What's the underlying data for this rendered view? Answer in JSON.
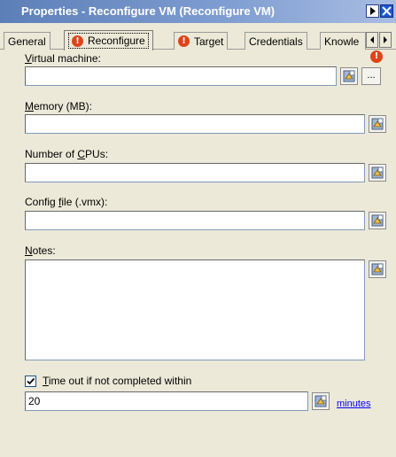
{
  "window": {
    "title": "Properties - Reconfigure VM (Reconfigure VM)"
  },
  "tabs": [
    {
      "label": "General",
      "error": false
    },
    {
      "label": "Reconfigure",
      "error": true
    },
    {
      "label": "Target",
      "error": true
    },
    {
      "label": "Credentials",
      "error": false
    },
    {
      "label": "Knowle",
      "error": false
    }
  ],
  "fields": {
    "virtual_machine": {
      "label_pre": "",
      "label_key": "V",
      "label_post": "irtual machine:",
      "value": ""
    },
    "memory": {
      "label_pre": "",
      "label_key": "M",
      "label_post": "emory (MB):",
      "value": ""
    },
    "cpus": {
      "label_pre": "Number of ",
      "label_key": "C",
      "label_post": "PUs:",
      "value": ""
    },
    "config_file": {
      "label_pre": "Config ",
      "label_key": "f",
      "label_post": "ile (.vmx):",
      "value": ""
    },
    "notes": {
      "label_pre": "",
      "label_key": "N",
      "label_post": "otes:",
      "value": ""
    }
  },
  "browse_label": "...",
  "timeout": {
    "checked": true,
    "label_pre": "",
    "label_key": "T",
    "label_post": "ime out if not completed within",
    "value": "20",
    "unit_link": "minutes"
  },
  "icons": {
    "error": "error-exclamation-icon",
    "field_browse": "insert-variable-icon"
  },
  "colors": {
    "title_gradient_start": "#5d7fb8",
    "error_red": "#e0421a",
    "link_blue": "#0000ff"
  }
}
